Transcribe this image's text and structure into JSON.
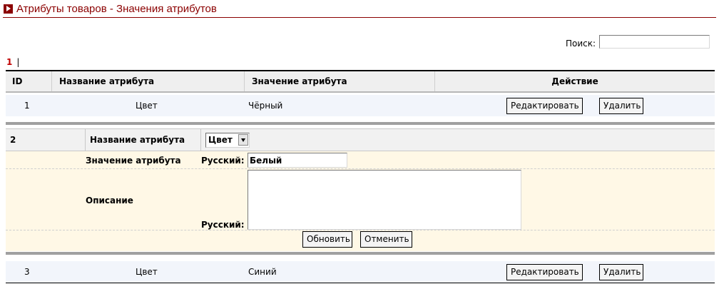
{
  "header": {
    "title": "Атрибуты товаров - Значения атрибутов"
  },
  "search": {
    "label": "Поиск:",
    "value": ""
  },
  "pager": {
    "current": "1",
    "separator": "|"
  },
  "grid": {
    "columns": [
      "ID",
      "Название атрибута",
      "Значение атрибута",
      "Действие"
    ],
    "rows": [
      {
        "id": "1",
        "name": "Цвет",
        "value": "Чёрный",
        "edit_label": "Редактировать",
        "delete_label": "Удалить"
      },
      {
        "id": "3",
        "name": "Цвет",
        "value": "Синий",
        "edit_label": "Редактировать",
        "delete_label": "Удалить"
      }
    ]
  },
  "edit_form": {
    "id": "2",
    "name_label": "Название атрибута",
    "attribute_select": {
      "selected": "Цвет"
    },
    "value_label": "Значение атрибута",
    "language_label": "Русский:",
    "value_input": "Белый",
    "description_label": "Описание",
    "description_language_label": "Русский:",
    "description_value": "",
    "update_label": "Обновить",
    "cancel_label": "Отменить"
  },
  "colors": {
    "brand": "#8b0000",
    "pager_active": "#c00000",
    "row_background": "#f2f5fb",
    "edit_background": "#fff8e6",
    "header_background": "#efefef"
  },
  "icons": {
    "title": "play-arrow-icon",
    "select": "chevron-down-icon"
  }
}
